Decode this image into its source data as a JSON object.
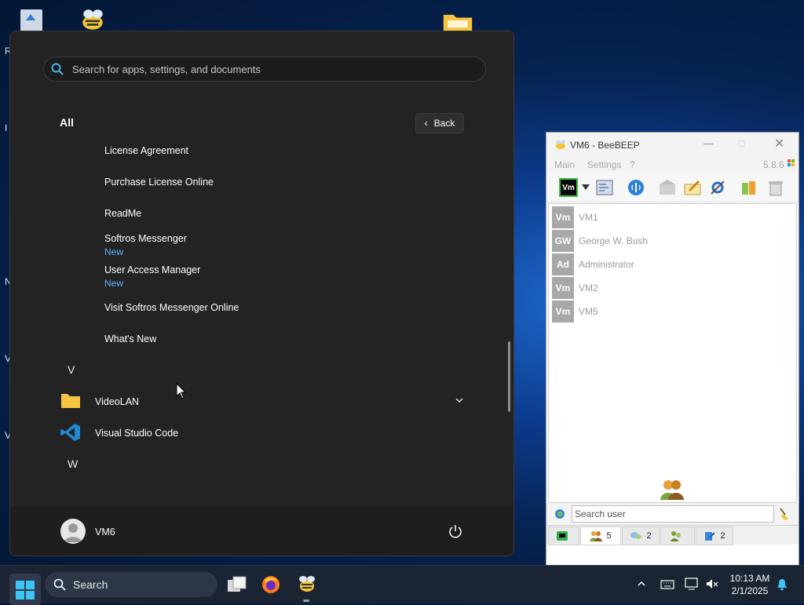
{
  "desktop": {
    "edge_letters": [
      "R",
      "I",
      "N",
      "V",
      "V"
    ]
  },
  "start_menu": {
    "search_placeholder": "Search for apps, settings, and documents",
    "section_title": "All",
    "back_label": "Back",
    "items": [
      {
        "label": "License Agreement",
        "badge": ""
      },
      {
        "label": "Purchase License Online",
        "badge": ""
      },
      {
        "label": "ReadMe",
        "badge": ""
      },
      {
        "label": "Softros Messenger",
        "badge": "New"
      },
      {
        "label": "User Access Manager",
        "badge": "New"
      },
      {
        "label": "Visit Softros Messenger Online",
        "badge": ""
      },
      {
        "label": "What's New",
        "badge": ""
      }
    ],
    "letters": [
      "V",
      "W"
    ],
    "apps": [
      {
        "label": "VideoLAN",
        "icon": "folder-icon"
      },
      {
        "label": "Visual Studio Code",
        "icon": "vscode-icon"
      }
    ],
    "user": "VM6"
  },
  "beebeep": {
    "title": "VM6 - BeeBEEP",
    "version": "5.8.6",
    "menu": [
      "Main",
      "Settings",
      "?"
    ],
    "status_badge": "Vm",
    "users": [
      {
        "badge": "Vm",
        "name": "VM1"
      },
      {
        "badge": "GW",
        "name": "George W. Bush"
      },
      {
        "badge": "Ad",
        "name": "Administrator"
      },
      {
        "badge": "Vm",
        "name": "VM2"
      },
      {
        "badge": "Vm",
        "name": "VM5"
      }
    ],
    "search_placeholder": "Search user",
    "tabs": [
      {
        "count": ""
      },
      {
        "count": "5"
      },
      {
        "count": "2"
      },
      {
        "count": ""
      },
      {
        "count": "2"
      }
    ]
  },
  "taskbar": {
    "search_label": "Search",
    "time": "10:13 AM",
    "date": "2/1/2025"
  },
  "colors": {
    "accent_blue": "#5fb0ff",
    "start_bg": "#232323",
    "taskbar_bg": "#1b2433"
  }
}
